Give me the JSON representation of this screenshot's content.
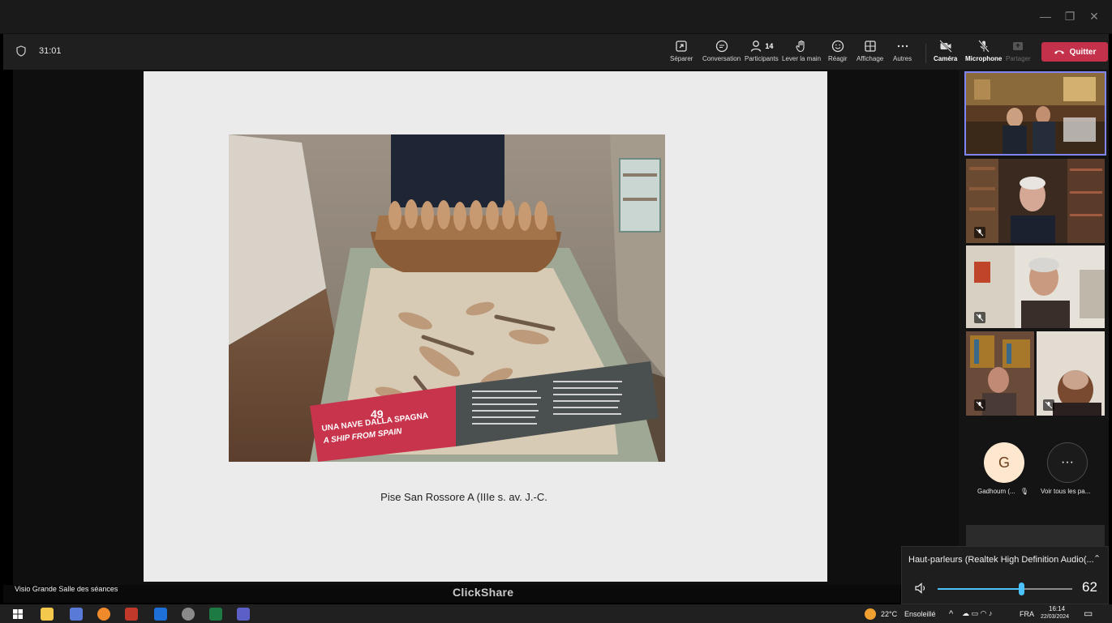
{
  "meeting": {
    "timer": "31:01",
    "toolbar": {
      "separer": "Séparer",
      "conversation": "Conversation",
      "participants": "Participants",
      "participants_count": "14",
      "lever_main": "Lever la main",
      "reagir": "Réagir",
      "affichage": "Affichage",
      "autres": "Autres",
      "camera": "Caméra",
      "microphone": "Microphone",
      "partager": "Partager",
      "quitter": "Quitter"
    }
  },
  "slide": {
    "caption": "Pise San Rossore A (IIIe s. av. J.-C.",
    "museum_sign_number": "49",
    "museum_sign_line1": "UNA NAVE DALLA SPAGNA",
    "museum_sign_line2": "A SHIP FROM SPAIN"
  },
  "participants_panel": {
    "avatar_initial": "G",
    "avatar_name": "Gadhoum (...",
    "more_label": "Voir tous les pa...",
    "more_icon": "ellipsis-icon"
  },
  "bottom": {
    "room_name": "Visio Grande Salle des séances",
    "clickshare": "ClickShare"
  },
  "volume": {
    "device": "Haut-parleurs (Realtek High Definition Audio(...",
    "level": 62,
    "level_text": "62"
  },
  "taskbar": {
    "weather_temp": "22°C",
    "weather_desc": "Ensoleillé",
    "language": "FRA",
    "time": "16:14",
    "date": "22/03/2024"
  },
  "colors": {
    "accent": "#7f85f5",
    "quit": "#c4314b",
    "volume": "#4cc2ff"
  }
}
